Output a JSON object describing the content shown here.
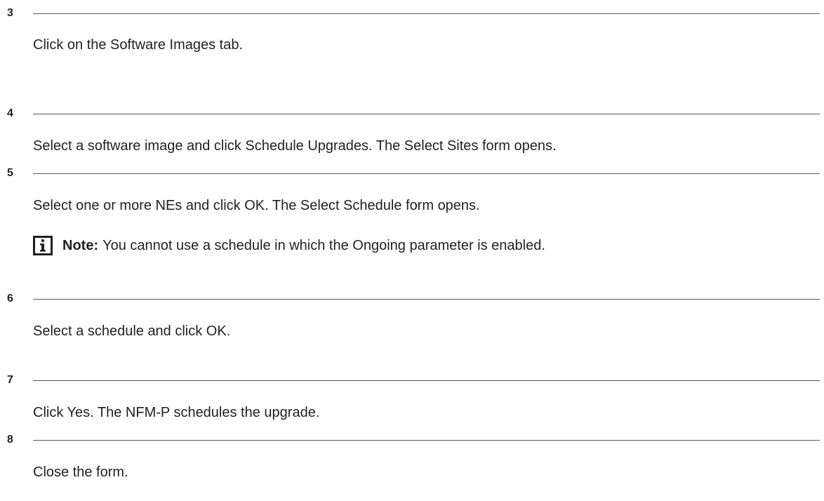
{
  "steps": [
    {
      "number": "3",
      "text": "Click on the Software Images tab."
    },
    {
      "number": "4",
      "text": "Select a software image and click Schedule Upgrades. The Select Sites form opens."
    },
    {
      "number": "5",
      "text": "Select one or more NEs and click OK. The Select Schedule form opens."
    },
    {
      "number": "6",
      "text": "Select a schedule and click OK."
    },
    {
      "number": "7",
      "text": "Click Yes. The NFM-P schedules the upgrade."
    },
    {
      "number": "8",
      "text": "Close the form."
    }
  ],
  "note": {
    "icon": "info-icon",
    "label": "Note:",
    "text": "You cannot use a schedule in which the Ongoing parameter is enabled."
  }
}
